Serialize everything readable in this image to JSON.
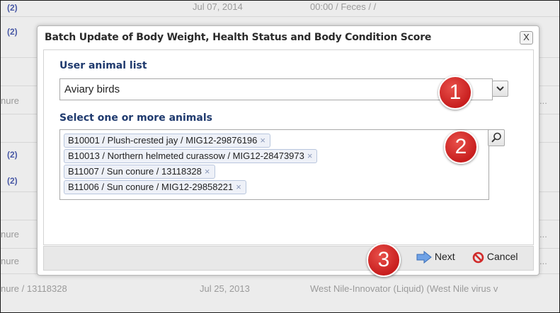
{
  "background": {
    "rows": [
      {
        "link": "(2)",
        "date": "Jul 07, 2014",
        "detail": "00:00 / Feces / /"
      },
      {
        "link": "(2)"
      },
      {
        "left_text": "nure",
        "ellipsis": "..."
      },
      {
        "link": "(2)"
      },
      {
        "link": "(2)"
      },
      {
        "left_text": "nure",
        "ellipsis": "..."
      },
      {
        "left_text": "nure",
        "ellipsis": "..."
      },
      {
        "left_text": "nure / 13118328",
        "date": "Jul 25, 2013",
        "detail": "West Nile-Innovator (Liquid) (West Nile virus v"
      }
    ]
  },
  "dialog": {
    "title": "Batch Update of Body Weight, Health Status and Body Condition Score",
    "close_glyph": "X",
    "user_list_label": "User animal list",
    "user_list_value": "Aviary birds",
    "animals_label": "Select one or more animals",
    "selected_animals": [
      "B10001 / Plush-crested jay / MIG12-29876196",
      "B10013 / Northern helmeted curassow / MIG12-28473973",
      "B11007 / Sun conure / 13118328",
      "B11006 / Sun conure / MIG12-29858221"
    ],
    "tag_remove_glyph": "×",
    "next_label": "Next",
    "cancel_label": "Cancel"
  },
  "badges": [
    "1",
    "2",
    "3"
  ],
  "icons": {
    "dropdown": "chevron-down-icon",
    "search": "magnifier-icon",
    "next": "arrow-right-icon",
    "cancel": "no-sign-icon"
  },
  "colors": {
    "section_label": "#1f3a6e",
    "badge": "#c81e1e",
    "link": "#4a5aa6",
    "next_arrow": "#5b8fd8",
    "cancel_icon": "#d12b2b"
  }
}
